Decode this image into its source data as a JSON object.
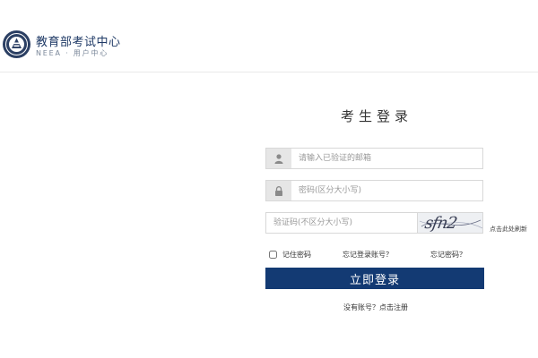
{
  "header": {
    "title": "教育部考试中心",
    "subtitle": "NEEA · 用户中心"
  },
  "login": {
    "title": "考生登录",
    "email_placeholder": "请输入已验证的邮箱",
    "password_placeholder": "密码(区分大小写)",
    "captcha_placeholder": "验证码(不区分大小写)",
    "captcha_text": "sfn2",
    "refresh_label": "点击此处刷新",
    "remember_label": "记住密码",
    "forgot_account_label": "忘记登录账号？",
    "forgot_password_label": "忘记密码？",
    "submit_label": "立即登录",
    "register_label": "没有账号？点击注册"
  },
  "icons": {
    "email_field_icon": "user-icon",
    "password_field_icon": "lock-icon"
  },
  "colors": {
    "brand": "#133a73"
  }
}
